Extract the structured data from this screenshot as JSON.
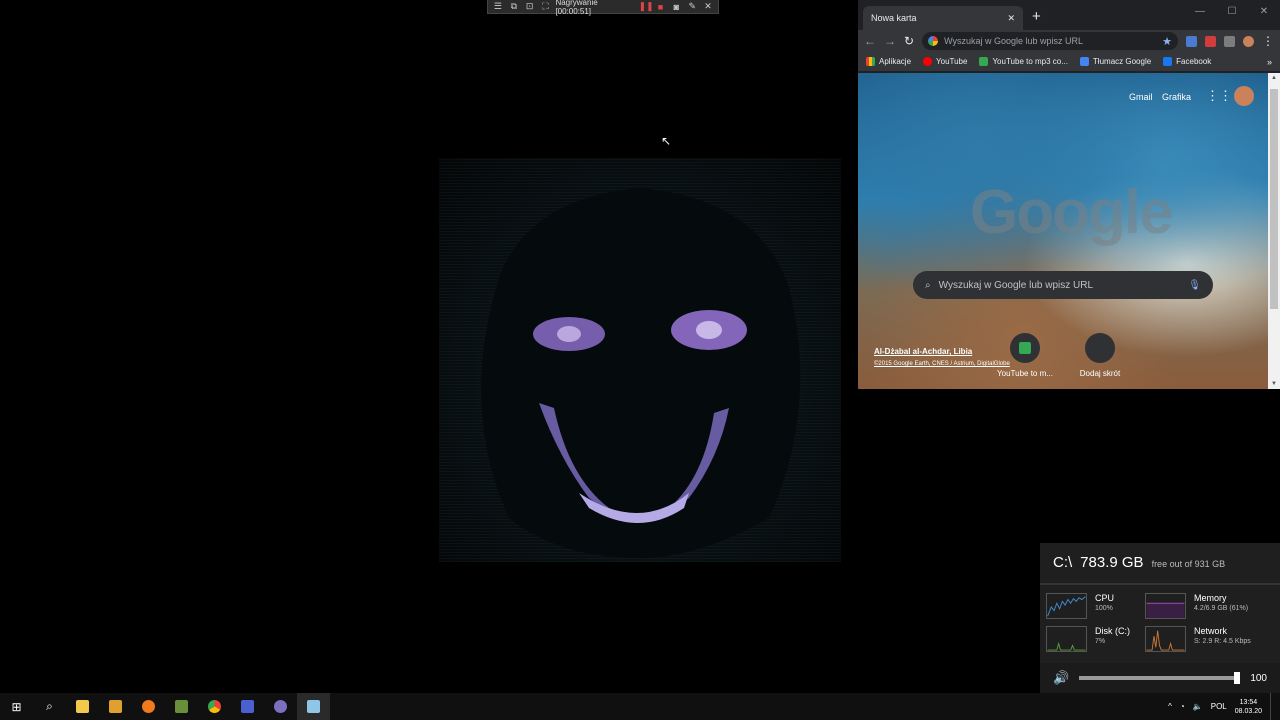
{
  "recorder": {
    "label": "Nagrywanie [00:00:51]"
  },
  "chrome": {
    "tab_title": "Nowa karta",
    "omnibox_placeholder": "Wyszukaj w Google lub wpisz URL",
    "bookmarks": [
      {
        "label": "Aplikacje",
        "color": "#ea4335"
      },
      {
        "label": "YouTube",
        "color": "#ff0000"
      },
      {
        "label": "YouTube to mp3 co...",
        "color": "#34a853"
      },
      {
        "label": "Tłumacz Google",
        "color": "#4285f4"
      },
      {
        "label": "Facebook",
        "color": "#1877f2"
      }
    ],
    "ntp": {
      "gmail": "Gmail",
      "images": "Grafika",
      "logo": "Google",
      "search_placeholder": "Wyszukaj w Google lub wpisz URL",
      "location": "Al-Dżabal al-Achdar, Libia",
      "copyright": "©2015 Google Earth, CNES / Astrium, DigitalGlobe",
      "tiles": [
        {
          "label": "YouTube to m..."
        },
        {
          "label": "Dodaj skrót"
        }
      ]
    }
  },
  "widget": {
    "drive": "C:\\",
    "free": "783.9 GB",
    "free_suffix": "free out of 931 GB",
    "cpu": {
      "title": "CPU",
      "value": "100%",
      "color": "#3d8fd6"
    },
    "memory": {
      "title": "Memory",
      "value": "4.2/6.9 GB (61%)",
      "color": "#9b4fb5"
    },
    "disk": {
      "title": "Disk (C:)",
      "value": "7%",
      "color": "#55a33a"
    },
    "network": {
      "title": "Network",
      "value": "S: 2.9  R: 4.5 Kbps",
      "color": "#c8783a"
    },
    "volume": "100"
  },
  "taskbar": {
    "lang": "POL",
    "time": "13:54",
    "date": "08.03.20"
  }
}
